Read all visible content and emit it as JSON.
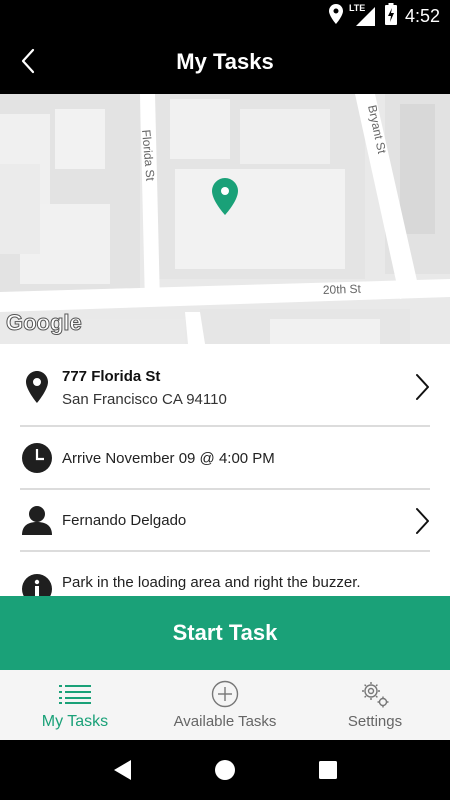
{
  "status_bar": {
    "time": "4:52",
    "network": "LTE",
    "icons": [
      "location-icon",
      "signal-icon",
      "battery-charging-icon"
    ]
  },
  "app_bar": {
    "title": "My Tasks",
    "back_icon": "chevron-left-icon"
  },
  "map": {
    "streets": [
      "Florida St",
      "Bryant St",
      "20th St"
    ],
    "attribution": "Google",
    "pin_color": "#1aa178"
  },
  "task": {
    "address_line1": "777 Florida St",
    "address_line2": "San Francisco CA 94110",
    "arrival": "Arrive November 09  @ 4:00 PM",
    "contact": "Fernando Delgado",
    "note": "Park in the loading area and right the buzzer."
  },
  "actions": {
    "start_label": "Start Task"
  },
  "bottom_nav": {
    "items": [
      {
        "label": "My Tasks",
        "icon": "list-icon",
        "active": true
      },
      {
        "label": "Available Tasks",
        "icon": "plus-circle-icon",
        "active": false
      },
      {
        "label": "Settings",
        "icon": "gears-icon",
        "active": false
      }
    ]
  },
  "colors": {
    "accent": "#1aa178",
    "app_bar": "#000000",
    "map_bg": "#e9e9e9"
  }
}
